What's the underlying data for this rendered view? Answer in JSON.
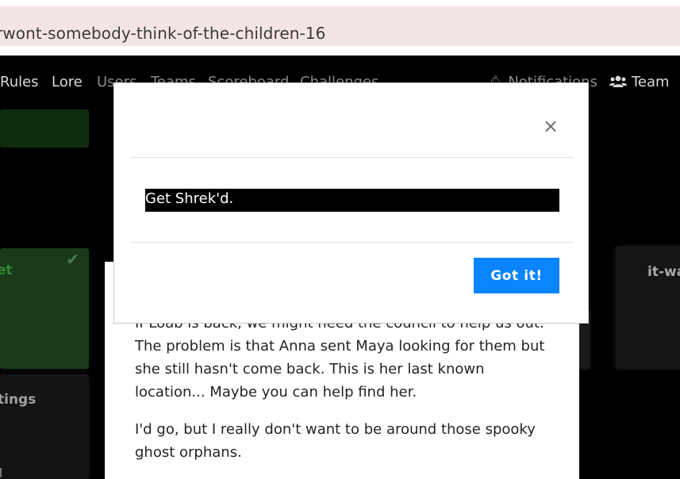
{
  "browser": {
    "url_fragment": "rwont-somebody-think-of-the-children-16"
  },
  "nav": {
    "left_links": [
      "Rules",
      "Lore",
      "Users",
      "Teams",
      "Scoreboard",
      "Challenges"
    ],
    "notifications_label": "Notifications",
    "team_label": "Team"
  },
  "background": {
    "green_card_label": "et",
    "dark_card_left_label": "tings",
    "dark_card_right_label": "it-wa"
  },
  "challenge": {
    "paragraph1": "If Loab is back, we might need the council to help us out. The problem is that Anna sent Maya looking for them but she still hasn't come back. This is her last known location... Maybe you can help find her.",
    "paragraph2": "I'd go, but I really don't want to be around those spooky ghost orphans."
  },
  "modal": {
    "close_symbol": "×",
    "hint_text": "Get Shrek'd.",
    "confirm_label": "Got it!"
  },
  "colors": {
    "accent": "#0a84ff",
    "url_bar": "#f4e5e5",
    "solved_card": "#1a3a1a"
  },
  "icons": {
    "notifications": "bell-icon",
    "team": "users-icon",
    "solved": "check-icon",
    "close": "close-icon"
  }
}
